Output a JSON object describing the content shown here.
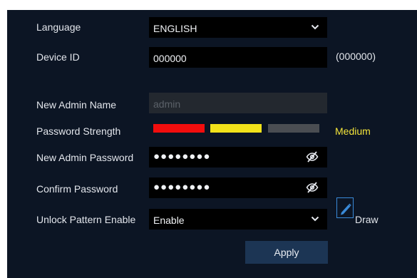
{
  "language": {
    "label": "Language",
    "value": "ENGLISH"
  },
  "device_id": {
    "label": "Device ID",
    "value": "000000",
    "hint": "(000000)"
  },
  "admin_name": {
    "label": "New Admin Name",
    "placeholder": "admin"
  },
  "password_strength": {
    "label": "Password Strength",
    "level_text": "Medium",
    "colors": [
      "#f20d0d",
      "#f2e21a",
      "#4a4d52"
    ]
  },
  "admin_password": {
    "label": "New Admin Password",
    "masked_value": "●●●●●●●●"
  },
  "confirm_password": {
    "label": "Confirm Password",
    "masked_value": "●●●●●●●●"
  },
  "unlock_pattern": {
    "label": "Unlock Pattern Enable",
    "value": "Enable",
    "draw_label": "Draw"
  },
  "apply_label": "Apply",
  "colors": {
    "panel_bg": "#0c1524",
    "field_bg": "#000000",
    "button_bg": "#1c3554",
    "accent": "#3a8ad8"
  }
}
